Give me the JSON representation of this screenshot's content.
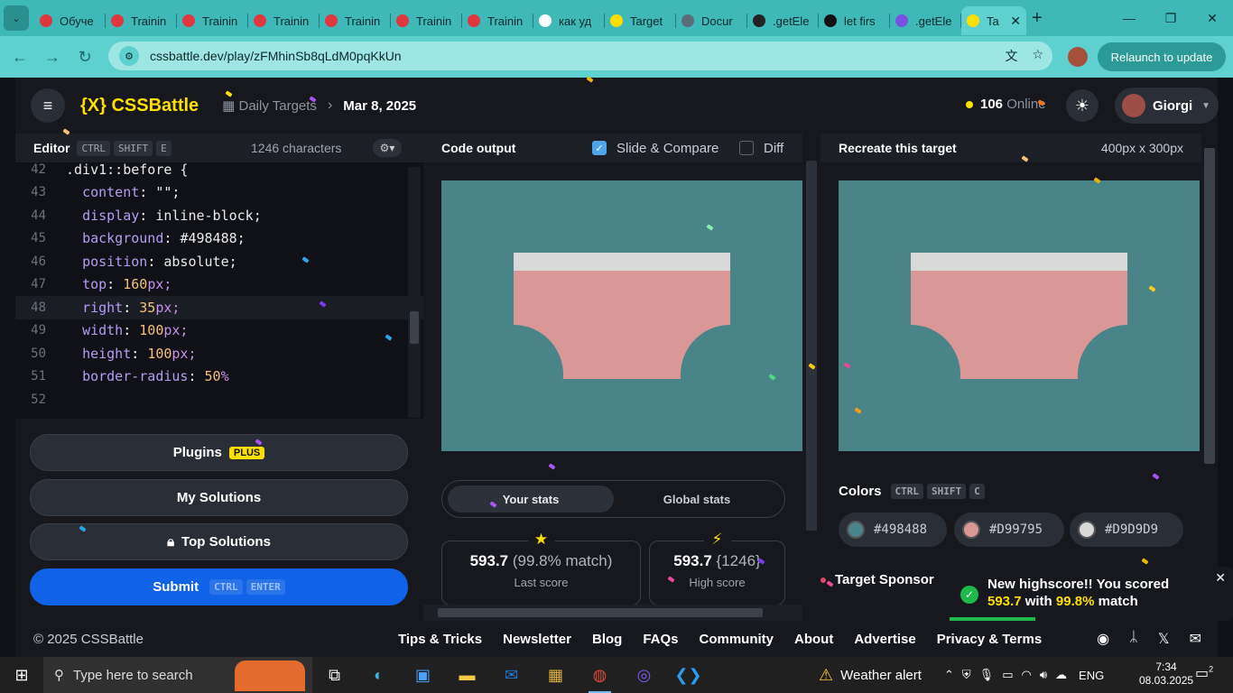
{
  "browser": {
    "tabs": [
      {
        "title": "Обуче",
        "color": "#e0363f"
      },
      {
        "title": "Trainin",
        "color": "#e0363f"
      },
      {
        "title": "Trainin",
        "color": "#e0363f"
      },
      {
        "title": "Trainin",
        "color": "#e0363f"
      },
      {
        "title": "Trainin",
        "color": "#e0363f"
      },
      {
        "title": "Trainin",
        "color": "#e0363f"
      },
      {
        "title": "Trainin",
        "color": "#e0363f"
      },
      {
        "title": "как уд",
        "color": "#ffffff"
      },
      {
        "title": "Target",
        "color": "#ffdf00"
      },
      {
        "title": "Docur",
        "color": "#5a6e76"
      },
      {
        "title": ".getEle",
        "color": "#222222"
      },
      {
        "title": "let firs",
        "color": "#111111"
      },
      {
        "title": ".getEle",
        "color": "#7a52e0"
      },
      {
        "title": "Ta",
        "color": "#ffdf00"
      }
    ],
    "url": "cssbattle.dev/play/zFMhinSb8qLdM0pqKkUn",
    "relaunch_label": "Relaunch to update"
  },
  "header": {
    "logo": "{X} CSSBattle",
    "crumb1": "Daily Targets",
    "crumb2": "Mar 8, 2025",
    "online_count": "106",
    "online_label": "Online",
    "username": "Giorgi"
  },
  "editor": {
    "title": "Editor",
    "shortcut": [
      "CTRL",
      "SHIFT",
      "E"
    ],
    "char_count": "1246 characters",
    "lines": [
      {
        "n": "42",
        "text": ".div1::before {"
      },
      {
        "n": "43",
        "prop": "content",
        "value": "\"\";"
      },
      {
        "n": "44",
        "prop": "display",
        "value": "inline-block;"
      },
      {
        "n": "45",
        "prop": "background",
        "value": "#498488;"
      },
      {
        "n": "46",
        "prop": "position",
        "value": "absolute;"
      },
      {
        "n": "47",
        "prop": "top",
        "num": "160",
        "unit": "px;"
      },
      {
        "n": "48",
        "prop": "right",
        "num": "35",
        "unit": "px;"
      },
      {
        "n": "49",
        "prop": "width",
        "num": "100",
        "unit": "px;"
      },
      {
        "n": "50",
        "prop": "height",
        "num": "100",
        "unit": "px;"
      },
      {
        "n": "51",
        "prop": "border-radius",
        "num": "50",
        "unit": "%"
      },
      {
        "n": "52",
        "text": ""
      }
    ]
  },
  "buttons": {
    "plugins": "Plugins",
    "plus": "PLUS",
    "my_solutions": "My Solutions",
    "top_solutions": "Top Solutions",
    "submit": "Submit",
    "submit_shortcut": [
      "CTRL",
      "ENTER"
    ]
  },
  "output": {
    "title": "Code output",
    "slide_compare": "Slide & Compare",
    "slide_checked": true,
    "diff": "Diff",
    "diff_checked": false,
    "tab_your": "Your stats",
    "tab_global": "Global stats",
    "last_score": "593.7",
    "last_match": "(99.8% match)",
    "last_label": "Last score",
    "high_score": "593.7",
    "high_chars": "{1246}",
    "high_label": "High score"
  },
  "target": {
    "title": "Recreate this target",
    "size": "400px x 300px",
    "colors_title": "Colors",
    "colors_shortcut": [
      "CTRL",
      "SHIFT",
      "C"
    ],
    "colors": [
      "#498488",
      "#D99795",
      "#D9D9D9"
    ],
    "sponsor": "Target Sponsor"
  },
  "toast": {
    "line1": "New highscore!! You scored",
    "score": "593.7",
    "with": "with",
    "match": "99.8%",
    "match_word": "match"
  },
  "footer": {
    "copyright": "© 2025 CSSBattle",
    "links": [
      "Tips & Tricks",
      "Newsletter",
      "Blog",
      "FAQs",
      "Community",
      "About",
      "Advertise",
      "Privacy & Terms"
    ]
  },
  "taskbar": {
    "search_placeholder": "Type here to search",
    "weather": "Weather alert",
    "lang": "ENG",
    "time": "7:34",
    "date": "08.03.2025",
    "notif_count": "2"
  }
}
